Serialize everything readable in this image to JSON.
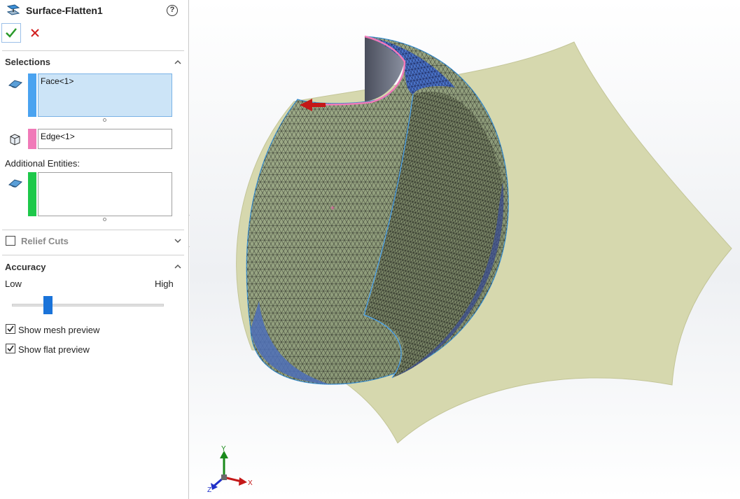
{
  "feature": {
    "title": "Surface-Flatten1",
    "ok_label": "OK",
    "cancel_label": "Cancel"
  },
  "selections": {
    "title": "Selections",
    "face_value": "Face<1>",
    "edge_value": "Edge<1>",
    "additional_label": "Additional Entities:",
    "additional_value": "",
    "face_color": "#4aa3f0",
    "edge_color": "#f07ab8",
    "additional_color": "#1ec84a"
  },
  "relief_cuts": {
    "label": "Relief Cuts",
    "checked": false
  },
  "accuracy": {
    "title": "Accuracy",
    "low_label": "Low",
    "high_label": "High",
    "level": 0.22
  },
  "options": {
    "show_mesh_label": "Show mesh preview",
    "show_mesh_checked": true,
    "show_flat_label": "Show flat preview",
    "show_flat_checked": true
  },
  "triad": {
    "x_label": "X",
    "y_label": "Y",
    "z_label": "Z"
  },
  "colors": {
    "flat_preview": "#d6d8ae",
    "mesh_face": "#9aa883",
    "accent": "#1a73d9"
  }
}
